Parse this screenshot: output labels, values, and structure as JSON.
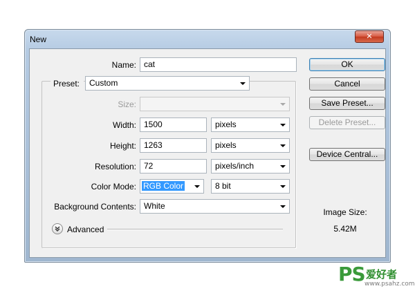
{
  "dialog": {
    "title": "New",
    "close_glyph": "✕"
  },
  "form": {
    "name_label": "Name:",
    "name_value": "cat",
    "preset_label": "Preset:",
    "preset_value": "Custom",
    "size_label": "Size:",
    "size_value": "",
    "width_label": "Width:",
    "width_value": "1500",
    "width_unit": "pixels",
    "height_label": "Height:",
    "height_value": "1263",
    "height_unit": "pixels",
    "resolution_label": "Resolution:",
    "resolution_value": "72",
    "resolution_unit": "pixels/inch",
    "color_mode_label": "Color Mode:",
    "color_mode_value": "RGB Color",
    "bit_depth_value": "8 bit",
    "background_label": "Background Contents:",
    "background_value": "White",
    "advanced_label": "Advanced"
  },
  "buttons": {
    "ok": "OK",
    "cancel": "Cancel",
    "save_preset": "Save Preset...",
    "delete_preset": "Delete Preset...",
    "device_central": "Device Central..."
  },
  "info": {
    "image_size_label": "Image Size:",
    "image_size_value": "5.42M"
  },
  "watermark": {
    "logo": "PS",
    "text": "爱好者",
    "url": "www.psahz.com"
  },
  "colors": {
    "selection": "#3399ff",
    "close_button": "#c23a1f",
    "default_button_border": "#3c7fb1"
  }
}
